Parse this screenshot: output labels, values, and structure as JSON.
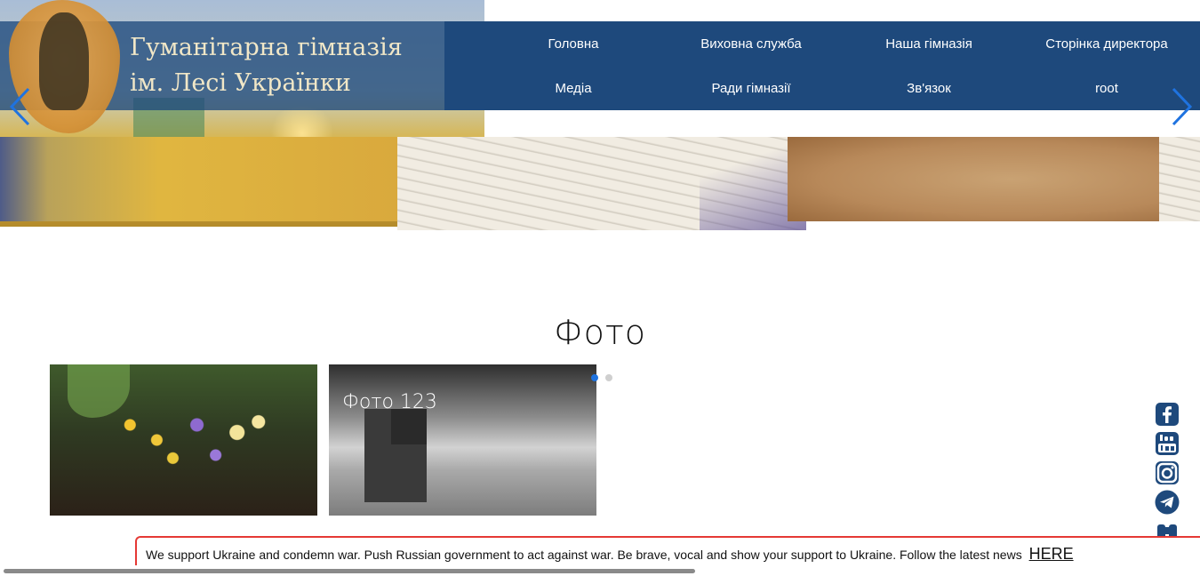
{
  "header": {
    "title_line1": "Гуманітарна гімназія",
    "title_line2": "ім. Лесі Українки"
  },
  "nav": {
    "items": [
      {
        "label": "Головна"
      },
      {
        "label": "Виховна служба"
      },
      {
        "label": "Наша гімназія"
      },
      {
        "label": "Сторінка директора"
      },
      {
        "label": "Медіа"
      },
      {
        "label": "Ради гімназії"
      },
      {
        "label": "Зв'язок"
      },
      {
        "label": "root"
      }
    ]
  },
  "slider": {
    "prev_icon": "chevron-left-icon",
    "next_icon": "chevron-right-icon",
    "arrow_color": "#1f73e0"
  },
  "photos": {
    "section_title": "Фото",
    "cards": [
      {
        "caption": ""
      },
      {
        "caption": "Фото 123"
      }
    ],
    "pagination_active": 1,
    "pagination_total": 2
  },
  "social": [
    "facebook-icon",
    "youtube-icon",
    "instagram-icon",
    "telegram-icon",
    "binoculars-icon"
  ],
  "banner": {
    "text": "We support Ukraine and condemn war. Push Russian government to act against war. Be brave, vocal and show your support to Ukraine. Follow the latest news",
    "link": "HERE",
    "border_color": "#e53935"
  },
  "colors": {
    "header_bg": "#1e497c",
    "title_color": "#f1e7c7",
    "accent": "#1f73e0"
  }
}
